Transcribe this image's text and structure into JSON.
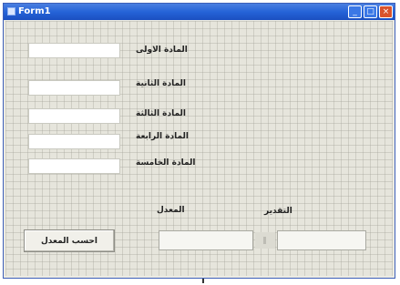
{
  "window": {
    "title": "Form1",
    "controls": {
      "minimize": "_",
      "maximize": "□",
      "close": "×"
    }
  },
  "form": {
    "fields": [
      {
        "label": "المادة الاولى",
        "value": ""
      },
      {
        "label": "المادة الثانية",
        "value": ""
      },
      {
        "label": "المادة الثالثة",
        "value": ""
      },
      {
        "label": "المادة الرابعة",
        "value": ""
      },
      {
        "label": "المادة الخامسة",
        "value": ""
      }
    ],
    "calc_button": "احسب المعدل",
    "results": [
      {
        "label": "المعدل",
        "value": ""
      },
      {
        "label": "التقدير",
        "value": ""
      }
    ]
  },
  "colors": {
    "titlebar": "#2563d8",
    "client_bg": "#e6e5dc",
    "field_bg": "#ffffff",
    "close_button": "#d9532c"
  },
  "icons": [
    "app-icon",
    "minimize-icon",
    "maximize-icon",
    "close-icon"
  ]
}
